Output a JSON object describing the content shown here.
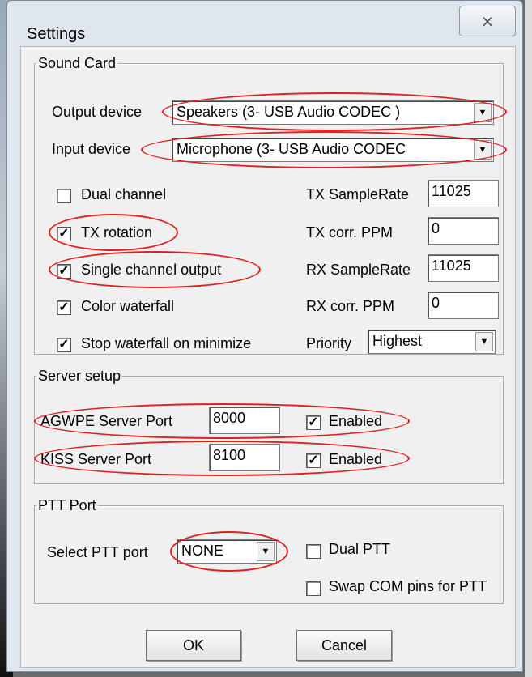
{
  "window": {
    "title": "Settings",
    "close_glyph": "⨯"
  },
  "sound_card": {
    "legend": "Sound Card",
    "output_label": "Output device",
    "output_value": "Speakers (3- USB Audio CODEC )",
    "input_label": "Input device",
    "input_value": "Microphone (3- USB Audio CODEC",
    "dual_channel": {
      "label": "Dual channel",
      "checked": ""
    },
    "tx_rotation": {
      "label": "TX rotation",
      "checked": "✓"
    },
    "single_channel_output": {
      "label": "Single channel output",
      "checked": "✓"
    },
    "color_waterfall": {
      "label": "Color waterfall",
      "checked": "✓"
    },
    "stop_waterfall": {
      "label": "Stop waterfall on minimize",
      "checked": "✓"
    },
    "tx_samplerate_label": "TX SampleRate",
    "tx_samplerate_value": "11025",
    "tx_corr_label": "TX corr. PPM",
    "tx_corr_value": "0",
    "rx_samplerate_label": "RX SampleRate",
    "rx_samplerate_value": "11025",
    "rx_corr_label": "RX corr. PPM",
    "rx_corr_value": "0",
    "priority_label": "Priority",
    "priority_value": "Highest"
  },
  "server_setup": {
    "legend": "Server setup",
    "agwpe_label": "AGWPE Server Port",
    "agwpe_value": "8000",
    "agwpe_enabled": {
      "label": "Enabled",
      "checked": "✓"
    },
    "kiss_label": "KISS Server Port",
    "kiss_value": "8100",
    "kiss_enabled": {
      "label": "Enabled",
      "checked": "✓"
    }
  },
  "ptt_port": {
    "legend": "PTT Port",
    "select_label": "Select PTT port",
    "select_value": "NONE",
    "dual_ptt": {
      "label": "Dual PTT",
      "checked": ""
    },
    "swap_com": {
      "label": "Swap COM pins for PTT",
      "checked": ""
    }
  },
  "buttons": {
    "ok": "OK",
    "cancel": "Cancel"
  },
  "colors": {
    "highlight_ring": "#e02020",
    "dialog_bg": "#f0f0f0"
  },
  "icons": {
    "combo_arrow": "▼"
  }
}
